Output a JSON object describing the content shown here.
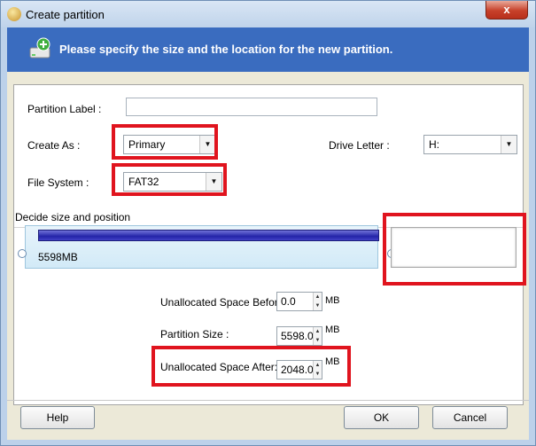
{
  "window": {
    "title": "Create partition",
    "close_glyph": "x"
  },
  "banner": {
    "text": "Please specify the size and the location for the new partition.",
    "icon": "add-disk-icon"
  },
  "form": {
    "partition_label": {
      "label": "Partition Label :",
      "value": ""
    },
    "create_as": {
      "label": "Create As :",
      "value": "Primary"
    },
    "drive_letter": {
      "label": "Drive Letter :",
      "value": "H:"
    },
    "file_system": {
      "label": "File System :",
      "value": "FAT32"
    }
  },
  "size_section": {
    "title": "Decide size and position",
    "partition_bar_label": "5598MB",
    "partition_fraction": 0.7321
  },
  "spinners": {
    "before": {
      "label": "Unallocated Space Before:",
      "value": "0.0",
      "unit": "MB"
    },
    "size": {
      "label": "Partition Size :",
      "value": "5598.0",
      "unit": "MB"
    },
    "after": {
      "label": "Unallocated Space After:",
      "value": "2048.0",
      "unit": "MB"
    }
  },
  "buttons": {
    "help": "Help",
    "ok": "OK",
    "cancel": "Cancel"
  },
  "colors": {
    "banner": "#3a6cbf",
    "highlight": "#e0141e",
    "bar": "#2424a8"
  }
}
